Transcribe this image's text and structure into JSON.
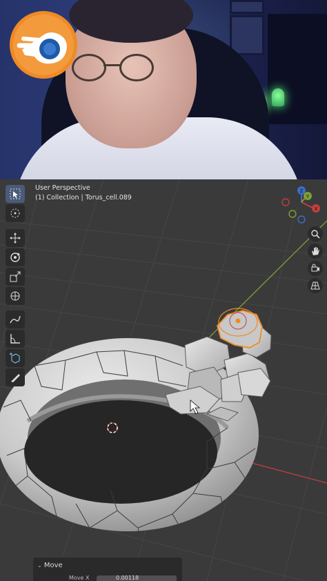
{
  "viewport": {
    "view_name": "User Perspective",
    "collection_line": "(1) Collection | Torus_cell.089"
  },
  "gizmo": {
    "axis_z": "Z",
    "axis_y": "Y",
    "axis_x": "X"
  },
  "toolbar": {
    "tools": [
      "select-box",
      "cursor",
      "move",
      "rotate",
      "scale",
      "transform",
      "annotate",
      "measure",
      "add-cube",
      "knife"
    ],
    "active_tool": "select-box"
  },
  "nav_buttons": [
    "zoom",
    "pan",
    "camera",
    "perspective-grid"
  ],
  "operator_panel": {
    "title": "Move",
    "field_label": "Move X",
    "field_value": "0.00118"
  },
  "colors": {
    "blender_orange": "#f08a24",
    "blender_blue": "#1f5aa6",
    "viewport_bg": "#3a3a3a",
    "axis_x_red": "#c0403f",
    "axis_y_green": "#7fa035",
    "selection_orange": "#f08a24"
  }
}
